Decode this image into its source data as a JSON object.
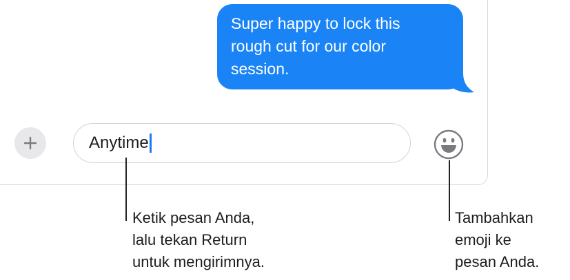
{
  "conversation": {
    "sent_message": "Super happy to lock this\nrough cut for our color\nsession."
  },
  "composer": {
    "input_value": "Anytime",
    "add_icon": "plus-icon",
    "emoji_icon": "smiley-icon"
  },
  "callouts": {
    "type_message": "Ketik pesan Anda,\nlalu tekan Return\nuntuk mengirimnya.",
    "add_emoji": "Tambahkan\nemoji ke\npesan Anda."
  },
  "colors": {
    "bubble": "#1a84f7",
    "caret": "#1a7cf5"
  }
}
